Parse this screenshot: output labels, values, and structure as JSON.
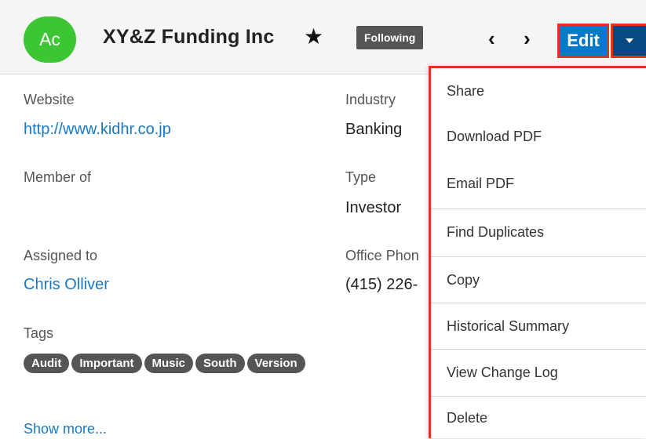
{
  "header": {
    "avatar_initials": "Ac",
    "title": "XY&Z Funding Inc",
    "favorite_icon": "star-icon",
    "following_label": "Following",
    "prev_label": "‹",
    "next_label": "›",
    "edit_label": "Edit",
    "accent_color": "#0679c8"
  },
  "fields": {
    "website_label": "Website",
    "website_value": "http://www.kidhr.co.jp",
    "industry_label": "Industry",
    "industry_value": "Banking",
    "member_of_label": "Member of",
    "type_label": "Type",
    "type_value": "Investor",
    "assigned_to_label": "Assigned to",
    "assigned_to_value": "Chris Olliver",
    "office_phone_label": "Office Phon",
    "office_phone_value": "(415) 226-",
    "tags_label": "Tags",
    "tags": [
      "Audit",
      "Important",
      "Music",
      "South",
      "Version"
    ],
    "show_more": "Show more..."
  },
  "menu": {
    "items": [
      "Share",
      "Download PDF",
      "Email PDF",
      "Find Duplicates",
      "Copy",
      "Historical Summary",
      "View Change Log",
      "Delete"
    ]
  }
}
